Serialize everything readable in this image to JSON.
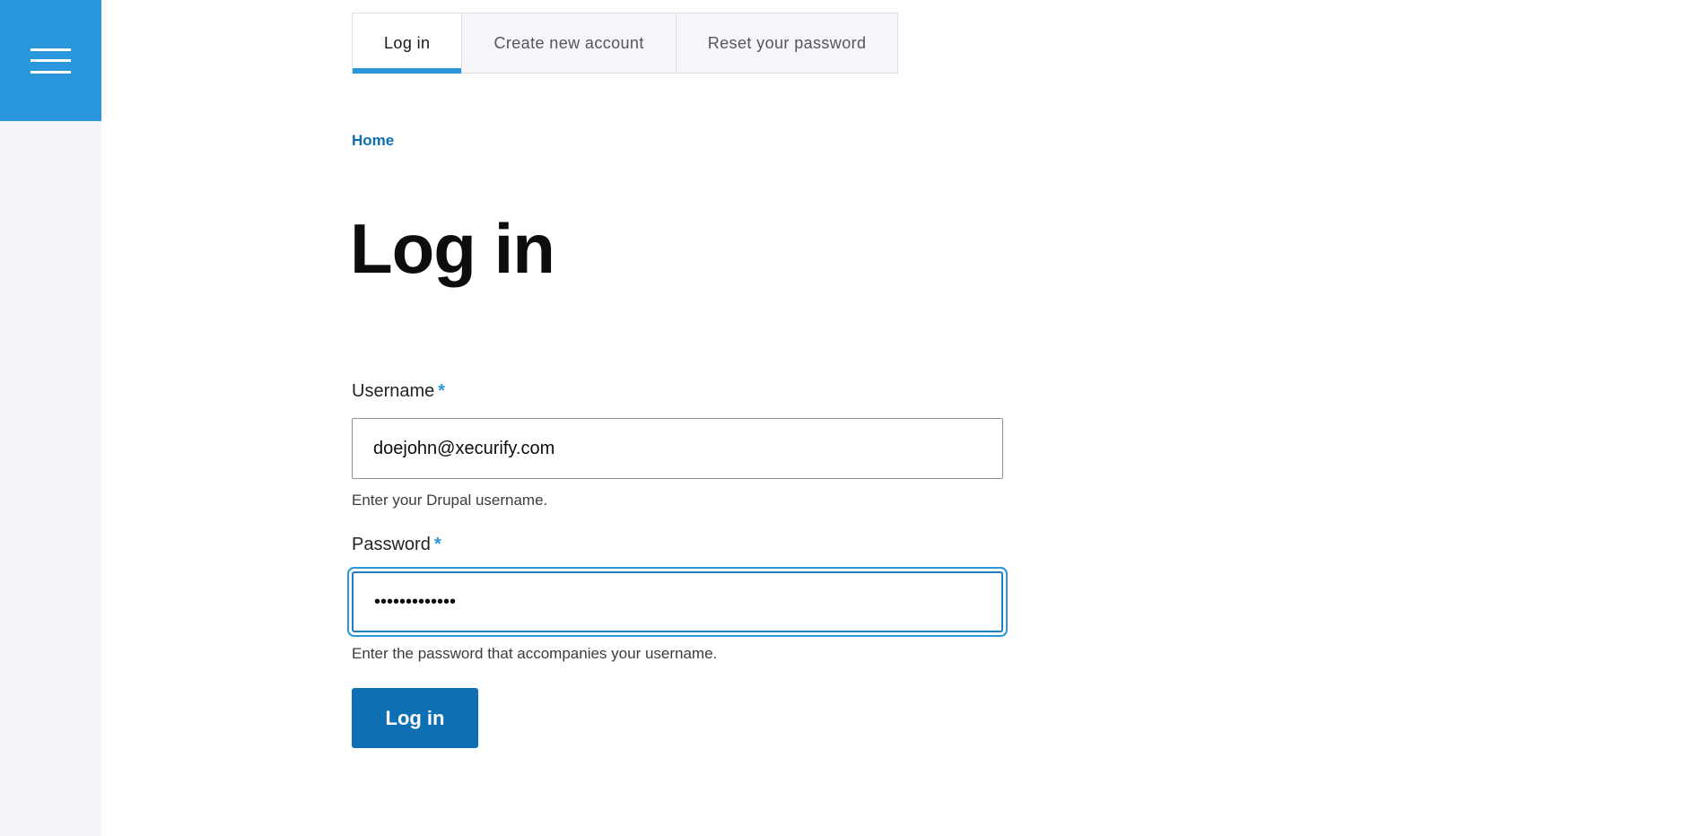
{
  "sidebar": {
    "menu_icon": "hamburger-menu-icon"
  },
  "tabs": [
    {
      "label": "Log in",
      "active": true
    },
    {
      "label": "Create new account",
      "active": false
    },
    {
      "label": "Reset your password",
      "active": false
    }
  ],
  "breadcrumb": {
    "home": "Home"
  },
  "page": {
    "title": "Log in"
  },
  "form": {
    "username": {
      "label": "Username",
      "required_marker": "*",
      "value": "doejohn@xecurify.com",
      "help": "Enter your Drupal username."
    },
    "password": {
      "label": "Password",
      "required_marker": "*",
      "value": "•••••••••••••",
      "help": "Enter the password that accompanies your username."
    },
    "submit_label": "Log in"
  },
  "colors": {
    "accent": "#2a96dc",
    "button": "#0f6fb3",
    "link": "#0e6fb1"
  }
}
